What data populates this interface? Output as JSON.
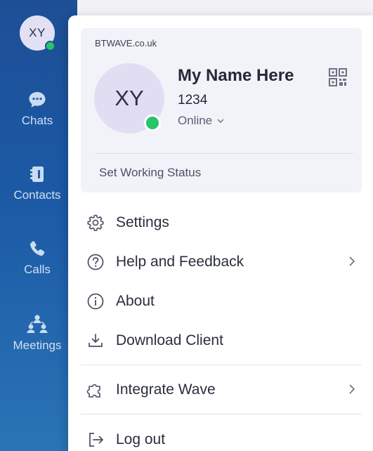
{
  "rail": {
    "avatar_initials": "XY",
    "items": [
      {
        "label": "Chats",
        "icon": "chat-bubble-icon"
      },
      {
        "label": "Contacts",
        "icon": "contacts-book-icon"
      },
      {
        "label": "Calls",
        "icon": "phone-icon"
      },
      {
        "label": "Meetings",
        "icon": "meeting-people-icon"
      }
    ]
  },
  "profile": {
    "domain": "BTWAVE.co.uk",
    "initials": "XY",
    "name": "My Name Here",
    "extension": "1234",
    "status": "Online",
    "working_status_label": "Set Working Status",
    "qr_icon": "qr-code-icon"
  },
  "menu": {
    "settings": {
      "label": "Settings",
      "icon": "gear-icon"
    },
    "help": {
      "label": "Help and Feedback",
      "icon": "question-circle-icon"
    },
    "about": {
      "label": "About",
      "icon": "info-circle-icon"
    },
    "download": {
      "label": "Download Client",
      "icon": "download-tray-icon"
    },
    "integrate": {
      "label": "Integrate Wave",
      "icon": "puzzle-icon"
    },
    "logout": {
      "label": "Log out",
      "icon": "logout-arrow-icon"
    }
  },
  "colors": {
    "rail_top": "#1d4f96",
    "rail_bottom": "#2a74b6",
    "online": "#27c46b",
    "avatar_bg": "#e1def4"
  }
}
